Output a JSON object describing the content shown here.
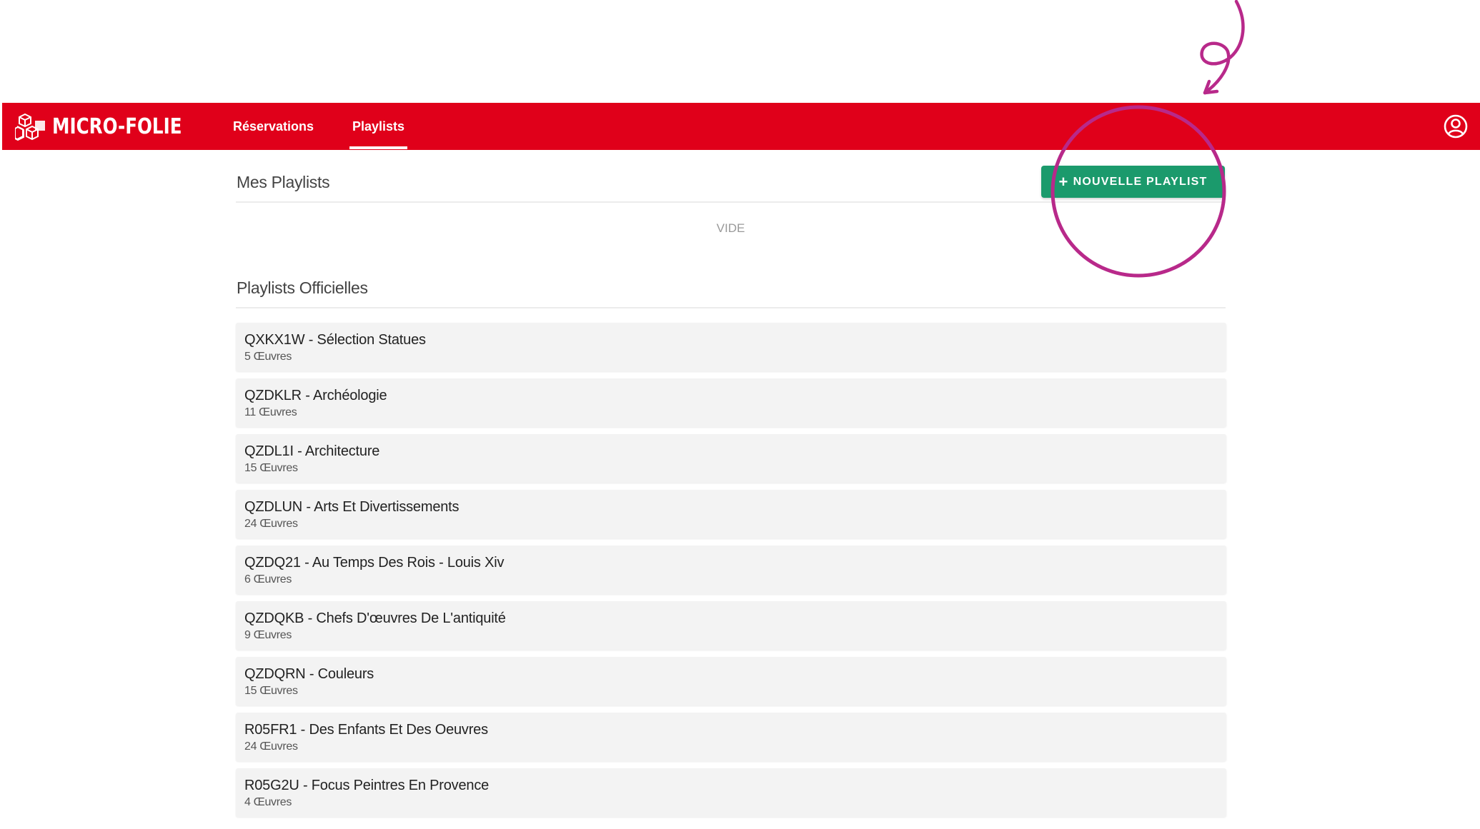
{
  "app": {
    "brand": "MICRO-FOLIE",
    "brand_color": "#e0001a",
    "accent_color": "#1b9a6c",
    "annotation_color": "#b8298a"
  },
  "nav": {
    "items": [
      {
        "label": "Réservations",
        "active": false
      },
      {
        "label": "Playlists",
        "active": true
      }
    ],
    "user_icon": "user-circle-icon"
  },
  "my_playlists": {
    "title": "Mes Playlists",
    "new_button_label": "NOUVELLE PLAYLIST",
    "new_button_icon": "plus-icon",
    "empty_label": "VIDE"
  },
  "official_playlists": {
    "title": "Playlists Officielles",
    "items": [
      {
        "title": "QXKX1W - Sélection Statues",
        "count": "5 Œuvres"
      },
      {
        "title": "QZDKLR - Archéologie",
        "count": "11 Œuvres"
      },
      {
        "title": "QZDL1I - Architecture",
        "count": "15 Œuvres"
      },
      {
        "title": "QZDLUN - Arts Et Divertissements",
        "count": "24 Œuvres"
      },
      {
        "title": "QZDQ21 - Au Temps Des Rois - Louis Xiv",
        "count": "6 Œuvres"
      },
      {
        "title": "QZDQKB - Chefs D'œuvres De L'antiquité",
        "count": "9 Œuvres"
      },
      {
        "title": "QZDQRN - Couleurs",
        "count": "15 Œuvres"
      },
      {
        "title": "R05FR1 - Des Enfants Et Des Oeuvres",
        "count": "24 Œuvres"
      },
      {
        "title": "R05G2U - Focus Peintres En Provence",
        "count": "4 Œuvres"
      }
    ]
  }
}
